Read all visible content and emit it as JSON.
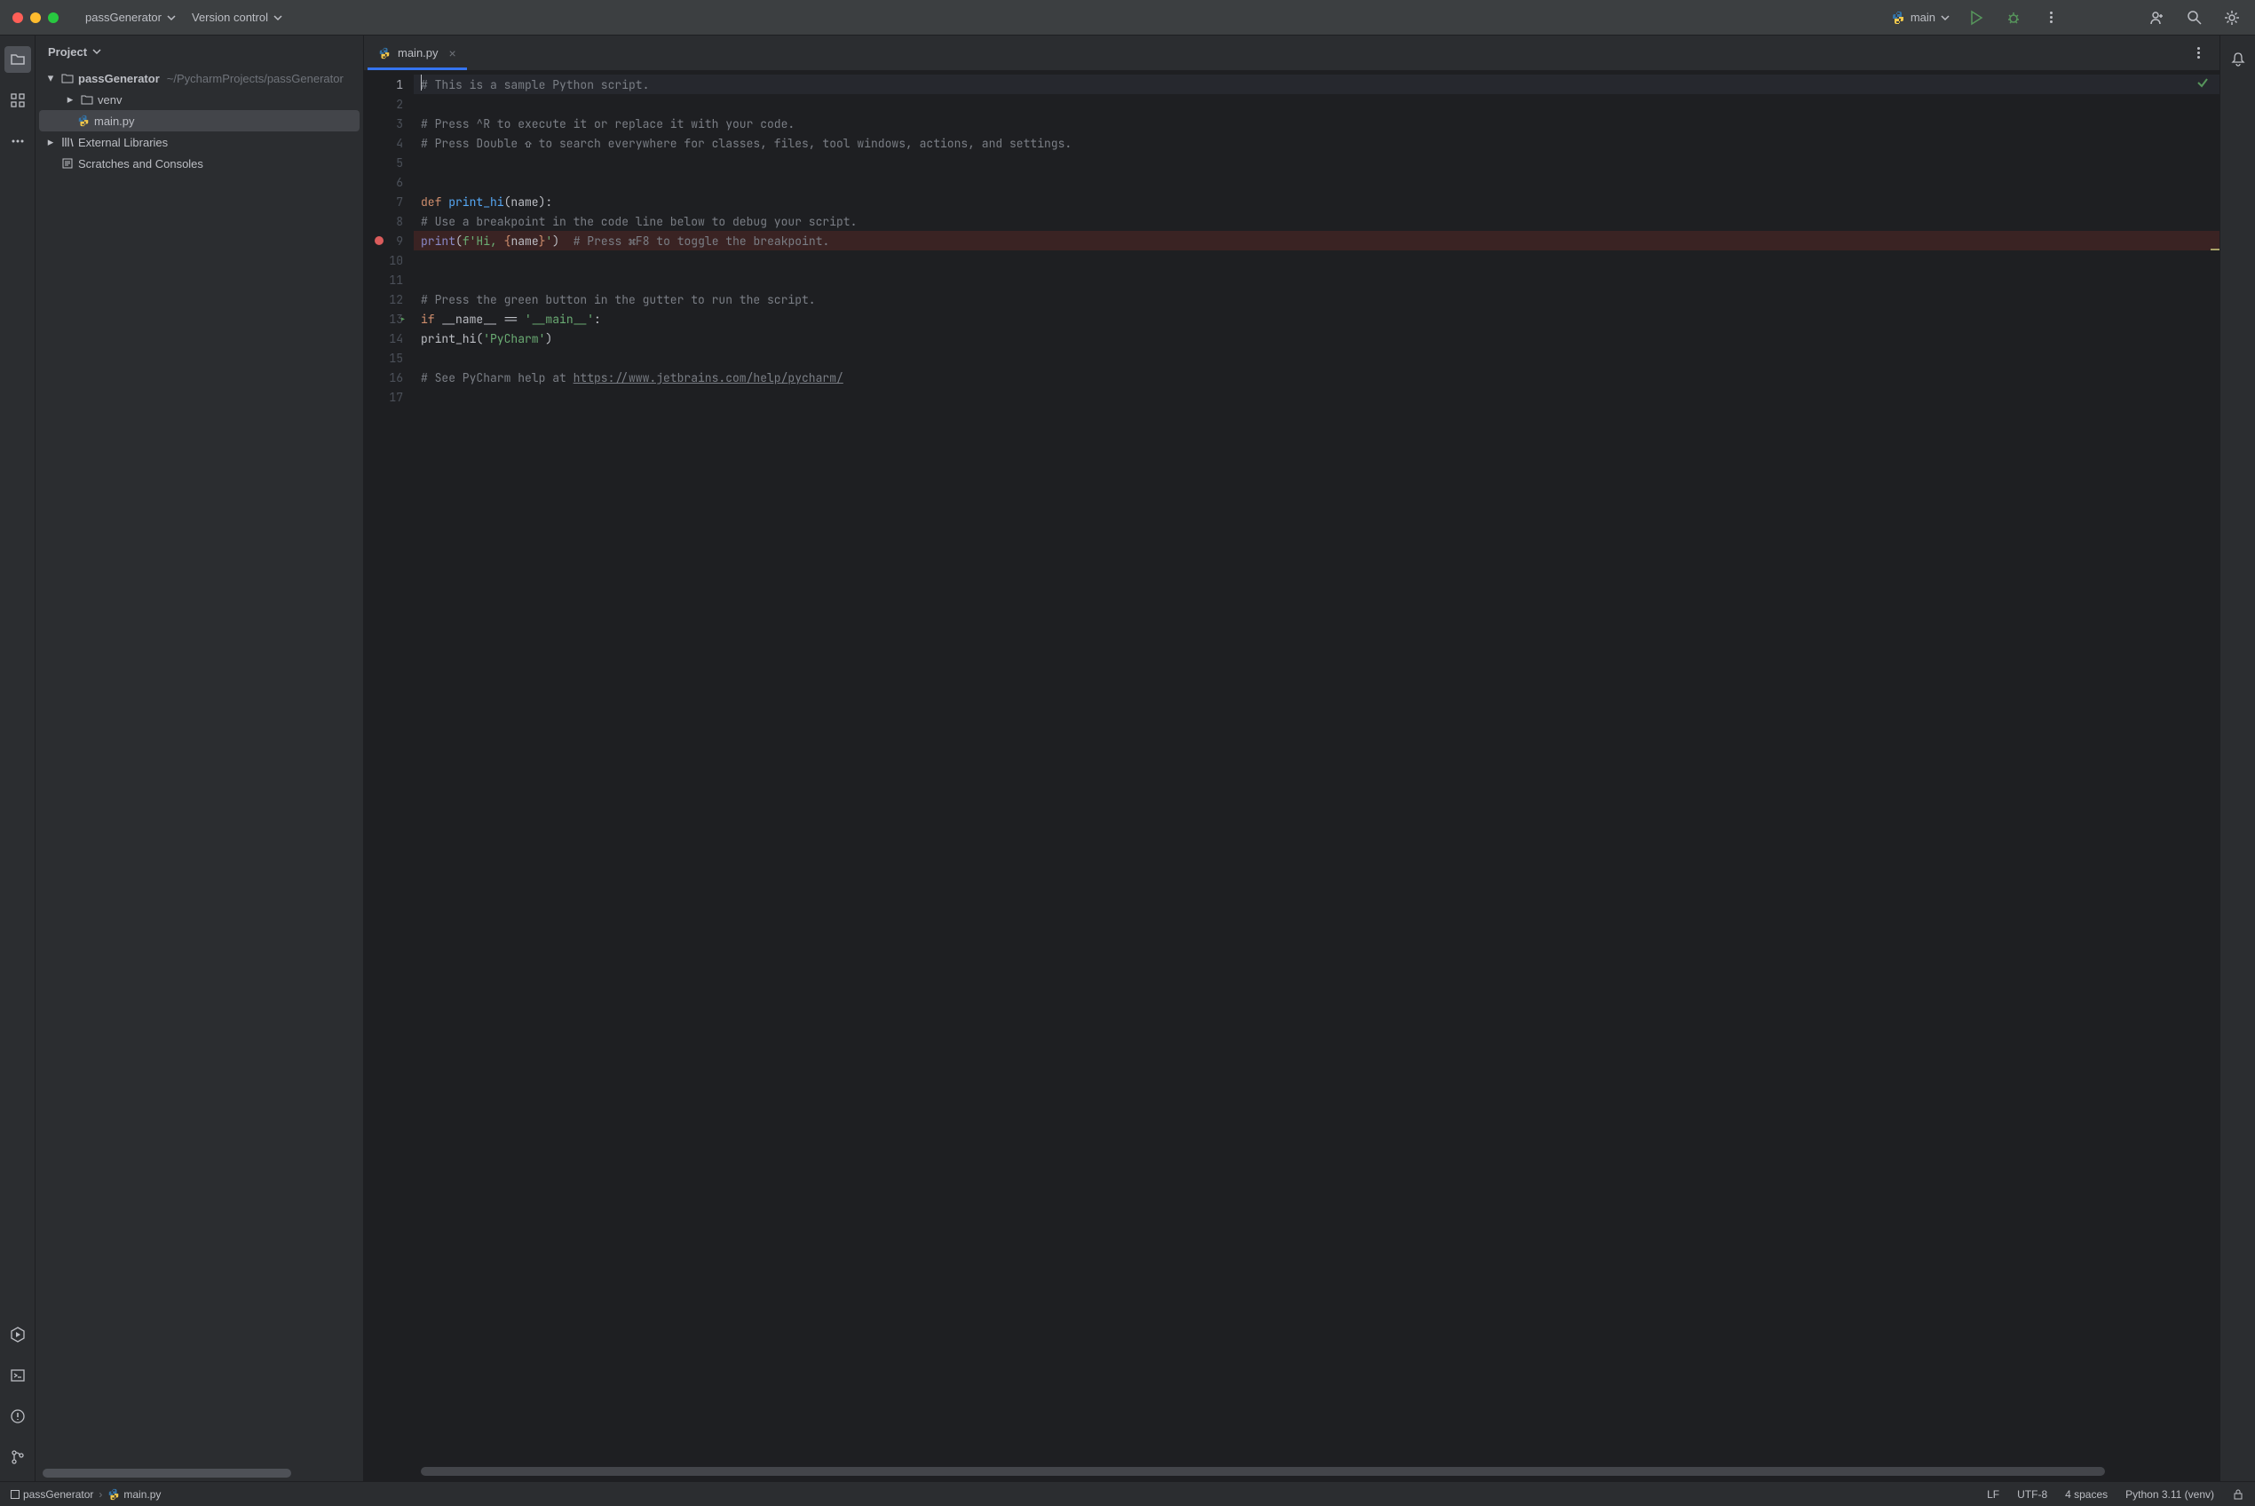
{
  "titlebar": {
    "project_menu": "passGenerator",
    "vcs_menu": "Version control",
    "config_label": "main",
    "search_label": "Search",
    "settings_label": "Settings"
  },
  "project_panel": {
    "title": "Project",
    "tree": {
      "root": {
        "name": "passGenerator",
        "path": "~/PycharmProjects/passGenerator"
      },
      "venv": "venv",
      "main": "main.py",
      "ext": "External Libraries",
      "scratch": "Scratches and Consoles"
    }
  },
  "editor": {
    "tab": {
      "name": "main.py"
    },
    "gutter_numbers": [
      "1",
      "2",
      "3",
      "4",
      "5",
      "6",
      "7",
      "8",
      "9",
      "10",
      "11",
      "12",
      "13",
      "14",
      "15",
      "16",
      "17"
    ],
    "breakpoint_line": 9,
    "run_line": 13,
    "code": {
      "l1": "# This is a sample Python script.",
      "l3": "# Press ^R to execute it or replace it with your code.",
      "l4": "# Press Double ⇧ to search everywhere for classes, files, tool windows, actions, and settings.",
      "l7_def": "def ",
      "l7_fn": "print_hi",
      "l7_rest": "(name):",
      "l8": "# Use a breakpoint in the code line below to debug your script.",
      "l9_print": "print",
      "l9_p1": "(",
      "l9_fstr1": "f'Hi, ",
      "l9_brace1": "{",
      "l9_name": "name",
      "l9_brace2": "}",
      "l9_fstr2": "'",
      "l9_p2": ")  ",
      "l9_com": "# Press ⌘F8 to toggle the breakpoint.",
      "l12": "# Press the green button in the gutter to run the script.",
      "l13_if": "if ",
      "l13_name": "__name__ == ",
      "l13_str": "'__main__'",
      "l13_colon": ":",
      "l14_fn": "print_hi(",
      "l14_str": "'PyCharm'",
      "l14_end": ")",
      "l16_pre": "# See PyCharm help at ",
      "l16_url": "https://www.jetbrains.com/help/pycharm/"
    }
  },
  "statusbar": {
    "crumb1": "passGenerator",
    "crumb2": "main.py",
    "line_sep": "LF",
    "encoding": "UTF-8",
    "indent": "4 spaces",
    "interpreter": "Python 3.11 (venv)"
  }
}
